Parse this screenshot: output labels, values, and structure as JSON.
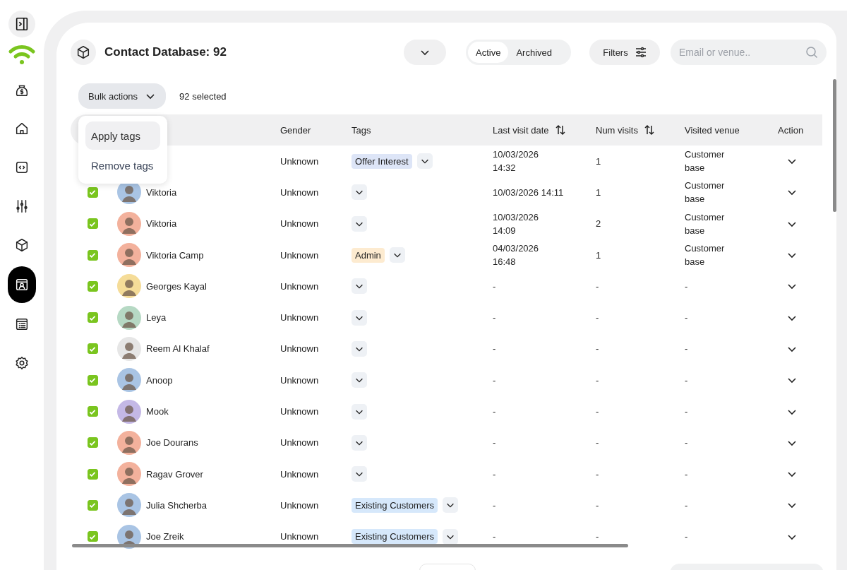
{
  "sidebar": {
    "items": [
      {
        "selected": false
      },
      {
        "selected": false
      },
      {
        "selected": false
      },
      {
        "selected": false
      },
      {
        "selected": false
      },
      {
        "selected": true
      },
      {
        "selected": false
      },
      {
        "selected": false
      }
    ]
  },
  "header": {
    "title": "Contact Database: 92",
    "segments": [
      {
        "label": "Active",
        "selected": true
      },
      {
        "label": "Archived",
        "selected": false
      }
    ],
    "filters_label": "Filters",
    "search": {
      "placeholder": "Email or venue.."
    }
  },
  "bulk": {
    "label": "Bulk actions",
    "selected_count": "92 selected",
    "menu": [
      {
        "label": "Apply tags",
        "selected": true
      },
      {
        "label": "Remove tags",
        "selected": false
      }
    ]
  },
  "table": {
    "columns": [
      {
        "label": "Gender",
        "sortable": false
      },
      {
        "label": "Tags",
        "sortable": false
      },
      {
        "label": "Last visit date",
        "sortable": true
      },
      {
        "label": "Num visits",
        "sortable": true
      },
      {
        "label": "Visited venue",
        "sortable": false
      },
      {
        "label": "Action",
        "sortable": false
      }
    ],
    "rows": [
      {
        "gender": "Unknown",
        "tags": [
          {
            "label": "Offer Interest",
            "color": "#dde5f7"
          }
        ],
        "last_visit": [
          "10/03/2026",
          "14:32"
        ],
        "visits": "1",
        "venue": "Customer base"
      },
      {
        "checked": true,
        "name": "Viktoria",
        "gender": "Unknown",
        "tags": [],
        "last_visit": [
          "10/03/2026 14:11"
        ],
        "visits": "1",
        "venue": "Customer base"
      },
      {
        "checked": true,
        "name": "Viktoria",
        "gender": "Unknown",
        "tags": [],
        "last_visit": [
          "10/03/2026",
          "14:09"
        ],
        "visits": "2",
        "venue": "Customer base"
      },
      {
        "checked": true,
        "name": "Viktoria Camp",
        "gender": "Unknown",
        "tags": [
          {
            "label": "Admin",
            "color": "#fdebd0"
          }
        ],
        "last_visit": [
          "04/03/2026",
          "16:48"
        ],
        "visits": "1",
        "venue": "Customer base"
      },
      {
        "checked": true,
        "name": "Georges Kayal",
        "gender": "Unknown",
        "tags": [],
        "last_visit": [
          "-"
        ],
        "visits": "-",
        "venue": "-"
      },
      {
        "checked": true,
        "name": "Leya",
        "gender": "Unknown",
        "tags": [],
        "last_visit": [
          "-"
        ],
        "visits": "-",
        "venue": "-"
      },
      {
        "checked": true,
        "name": "Reem Al Khalaf",
        "gender": "Unknown",
        "tags": [],
        "last_visit": [
          "-"
        ],
        "visits": "-",
        "venue": "-"
      },
      {
        "checked": true,
        "name": "Anoop",
        "gender": "Unknown",
        "tags": [],
        "last_visit": [
          "-"
        ],
        "visits": "-",
        "venue": "-"
      },
      {
        "checked": true,
        "name": "Mook",
        "gender": "Unknown",
        "tags": [],
        "last_visit": [
          "-"
        ],
        "visits": "-",
        "venue": "-"
      },
      {
        "checked": true,
        "name": "Joe Dourans",
        "gender": "Unknown",
        "tags": [],
        "last_visit": [
          "-"
        ],
        "visits": "-",
        "venue": "-"
      },
      {
        "checked": true,
        "name": "Ragav Grover",
        "gender": "Unknown",
        "tags": [],
        "last_visit": [
          "-"
        ],
        "visits": "-",
        "venue": "-"
      },
      {
        "checked": true,
        "name": "Julia Shcherba",
        "gender": "Unknown",
        "tags": [
          {
            "label": "Existing Customers",
            "color": "#d6e8fb"
          }
        ],
        "last_visit": [
          "-"
        ],
        "visits": "-",
        "venue": "-"
      },
      {
        "checked": true,
        "name": "Joe Zreik",
        "gender": "Unknown",
        "tags": [
          {
            "label": "Existing Customers",
            "color": "#d6e8fb"
          }
        ],
        "last_visit": [
          "-"
        ],
        "visits": "-",
        "venue": "-"
      }
    ]
  }
}
